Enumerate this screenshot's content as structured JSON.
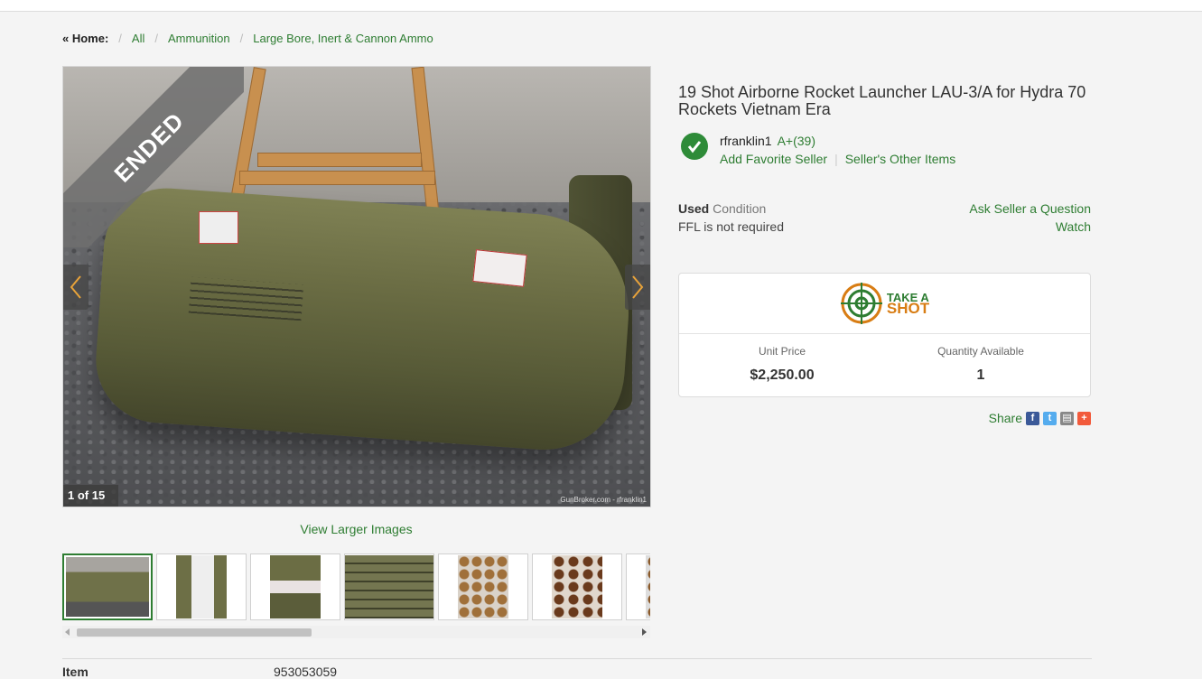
{
  "breadcrumb": {
    "home": "« Home:",
    "items": [
      "All",
      "Ammunition",
      "Large Bore, Inert & Cannon Ammo"
    ]
  },
  "gallery": {
    "ribbon": "ENDED",
    "counter": "1 of 15",
    "watermark": "GunBroker.com - rfranklin1",
    "view_larger": "View Larger Images",
    "prev_icon": "chevron-left-icon",
    "next_icon": "chevron-right-icon"
  },
  "listing": {
    "title": "19 Shot Airborne Rocket Launcher LAU-3/A for Hydra 70 Rockets Vietnam Era",
    "seller_name": "rfranklin1",
    "seller_rating": "A+(39)",
    "add_favorite": "Add Favorite Seller",
    "other_items": "Seller's Other Items",
    "condition_value": "Used",
    "condition_label": "Condition",
    "ffl": "FFL is not required",
    "ask_seller": "Ask Seller a Question",
    "watch": "Watch"
  },
  "pricing": {
    "take_a": "TAKE A",
    "shot": "SHOT",
    "unit_price_label": "Unit Price",
    "unit_price": "$2,250.00",
    "qty_label": "Quantity Available",
    "qty": "1"
  },
  "share": {
    "label": "Share"
  },
  "details": {
    "item_label": "Item",
    "item_value": "953053059"
  },
  "colors": {
    "accent": "#2e7d32",
    "check": "#2e8b38",
    "shot_orange": "#d87d14"
  }
}
